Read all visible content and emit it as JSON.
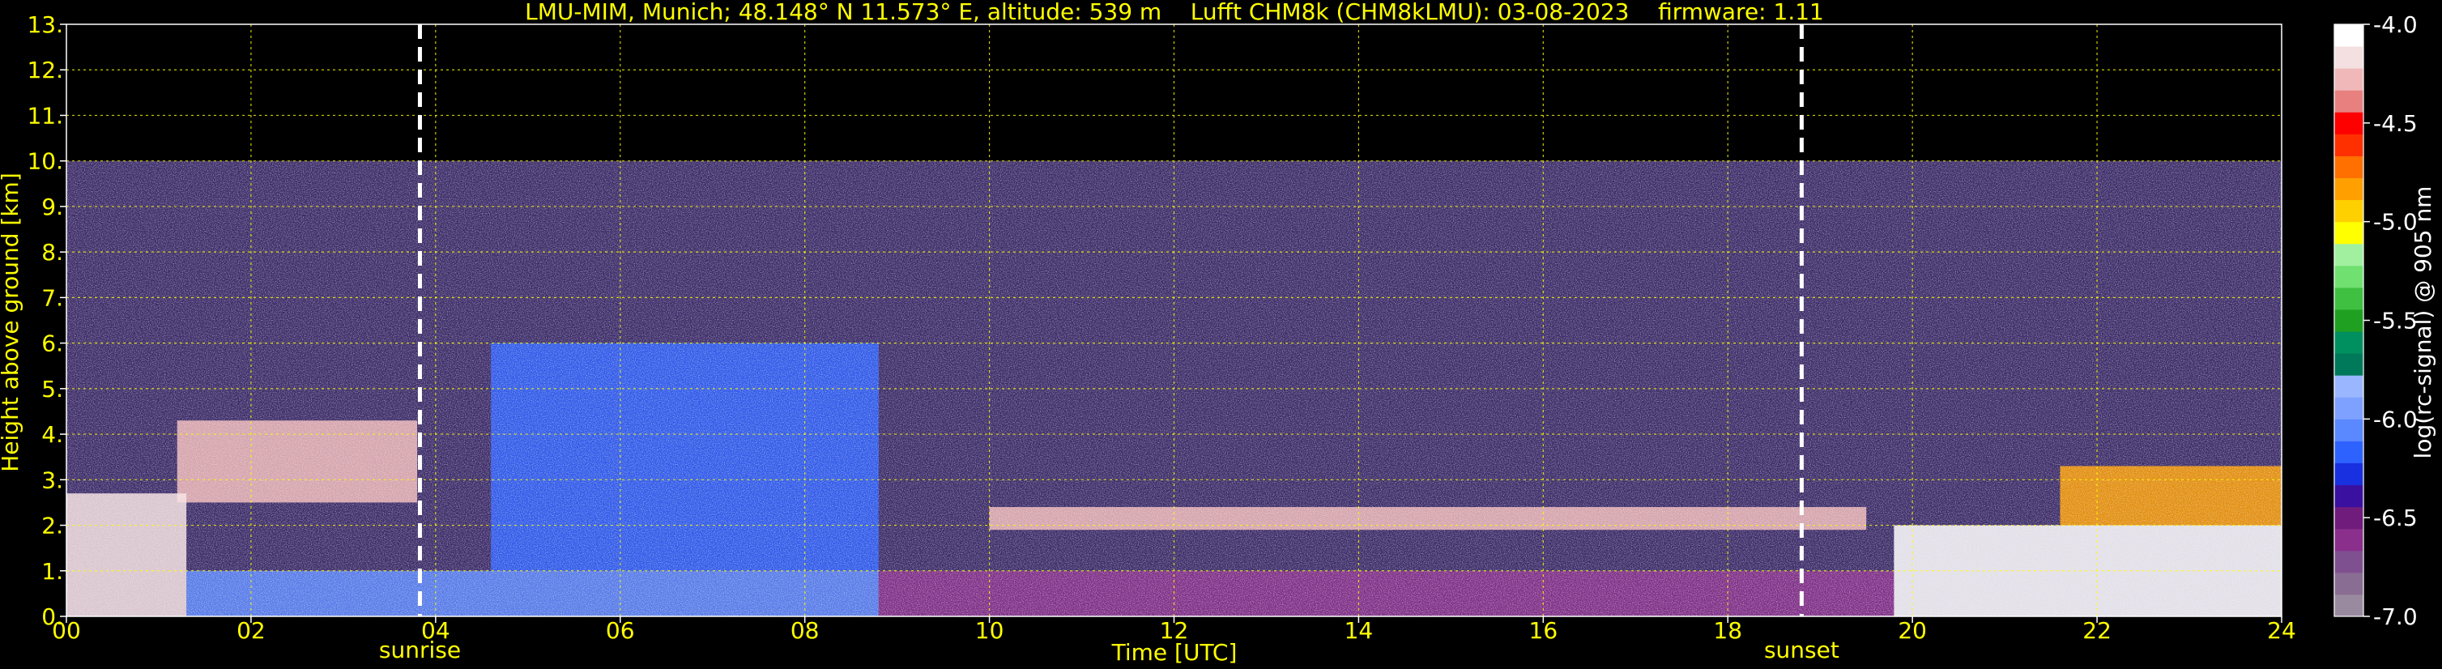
{
  "chart_data": {
    "type": "heatmap",
    "title": "LMU-MIM, Munich; 48.148° N 11.573° E, altitude: 539 m    Lufft CHM8k (CHM8kLMU): 03-08-2023    firmware: 1.11",
    "xlabel": "Time [UTC]",
    "ylabel": "Height above ground [km]",
    "xlim": [
      0,
      24
    ],
    "ylim": [
      0,
      13
    ],
    "x_tick_labels": [
      "00",
      "02",
      "04",
      "06",
      "08",
      "10",
      "12",
      "14",
      "16",
      "18",
      "20",
      "22",
      "24"
    ],
    "x_ticks": [
      0,
      2,
      4,
      6,
      8,
      10,
      12,
      14,
      16,
      18,
      20,
      22,
      24
    ],
    "y_tick_labels": [
      "0.",
      "1.",
      "2.",
      "3.",
      "4.",
      "5.",
      "6.",
      "7.",
      "8.",
      "9.",
      "10.",
      "11.",
      "12.",
      "13."
    ],
    "y_ticks": [
      0,
      1,
      2,
      3,
      4,
      5,
      6,
      7,
      8,
      9,
      10,
      11,
      12,
      13
    ],
    "grid": true,
    "markers": [
      {
        "label": "sunrise",
        "x": 3.83
      },
      {
        "label": "sunset",
        "x": 18.8
      }
    ],
    "measurement_top_km": 10,
    "colorbar": {
      "label": "log(rc-signal) @ 905 nm",
      "range": [
        -7.0,
        -4.0
      ],
      "tick_labels": [
        "-4.0",
        "-4.5",
        "-5.0",
        "-5.5",
        "-6.0",
        "-6.5",
        "-7.0"
      ],
      "ticks": [
        -4.0,
        -4.5,
        -5.0,
        -5.5,
        -6.0,
        -6.5,
        -7.0
      ],
      "colors": [
        "#9a8aa0",
        "#8a6d93",
        "#7f5090",
        "#8a2f8c",
        "#701c7c",
        "#3a10a0",
        "#1830e0",
        "#2e62ff",
        "#5a88ff",
        "#7ea0ff",
        "#9ab6ff",
        "#00785a",
        "#009060",
        "#20a020",
        "#40c040",
        "#70e070",
        "#a0f0a0",
        "#ffff00",
        "#ffd000",
        "#ffa000",
        "#ff7000",
        "#ff3000",
        "#ff0000",
        "#e88080",
        "#f0b8b8",
        "#f4e0e0",
        "#ffffff"
      ]
    },
    "features": [
      {
        "name": "boundary_layer_aerosol",
        "x": [
          1.3,
          8.8
        ],
        "height_km": [
          0,
          1.0
        ],
        "value": -6.1
      },
      {
        "name": "aerosol_layer_above",
        "x": [
          4.6,
          8.8
        ],
        "height_km": [
          1.0,
          6.0
        ],
        "value": -6.2
      },
      {
        "name": "near_ground_signal",
        "x": [
          8.8,
          19.8
        ],
        "height_km": [
          0,
          1.0
        ],
        "value": -6.6
      },
      {
        "name": "elevated_layer_trace",
        "x": [
          10.0,
          19.5
        ],
        "height_km": [
          1.9,
          2.4
        ],
        "value": -4.3
      },
      {
        "name": "morning_layer_trace",
        "x": [
          1.2,
          3.8
        ],
        "height_km": [
          2.5,
          4.3
        ],
        "value": -4.3
      },
      {
        "name": "night_low_cloud",
        "x": [
          0,
          1.3
        ],
        "height_km": [
          0,
          2.7
        ],
        "value": -4.2
      },
      {
        "name": "evening_cloud_field",
        "x": [
          19.8,
          24
        ],
        "height_km": [
          0,
          2.0
        ],
        "value": -4.0
      },
      {
        "name": "evening_cloud_tops",
        "x": [
          21.6,
          24
        ],
        "height_km": [
          2.0,
          3.3
        ],
        "value": -4.8
      }
    ]
  }
}
